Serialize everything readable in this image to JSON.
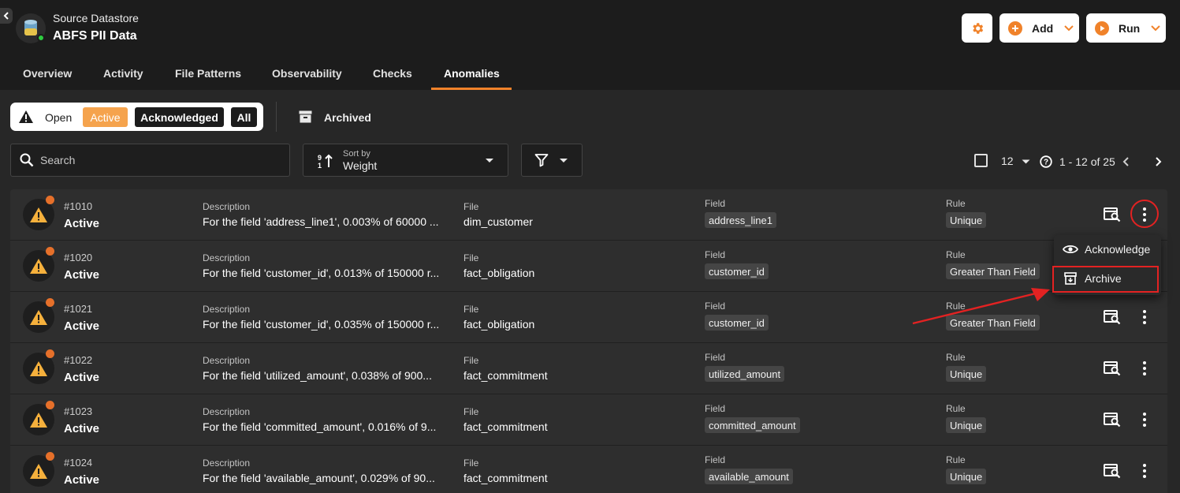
{
  "header": {
    "datastore_label": "Source Datastore",
    "datastore_name": "ABFS PII Data",
    "add_label": "Add",
    "run_label": "Run",
    "accent": "#f0822a"
  },
  "tabs": [
    "Overview",
    "Activity",
    "File Patterns",
    "Observability",
    "Checks",
    "Anomalies"
  ],
  "active_tab": "Anomalies",
  "status_filter": {
    "open": "Open",
    "active": "Active",
    "acknowledged": "Acknowledged",
    "all": "All",
    "archived": "Archived"
  },
  "search": {
    "placeholder": "Search"
  },
  "sort": {
    "small_label": "Sort by",
    "value": "Weight"
  },
  "pagination": {
    "page_size": "12",
    "range": "1 - 12 of 25"
  },
  "labels": {
    "description": "Description",
    "file": "File",
    "field": "Field",
    "rule": "Rule"
  },
  "anomalies": [
    {
      "id": "#1010",
      "status": "Active",
      "description": "For the field 'address_line1', 0.003% of 60000 ...",
      "file": "dim_customer",
      "field": "address_line1",
      "rule": "Unique"
    },
    {
      "id": "#1020",
      "status": "Active",
      "description": "For the field 'customer_id', 0.013% of 150000 r...",
      "file": "fact_obligation",
      "field": "customer_id",
      "rule": "Greater Than Field"
    },
    {
      "id": "#1021",
      "status": "Active",
      "description": "For the field 'customer_id', 0.035% of 150000 r...",
      "file": "fact_obligation",
      "field": "customer_id",
      "rule": "Greater Than Field"
    },
    {
      "id": "#1022",
      "status": "Active",
      "description": "For the field 'utilized_amount', 0.038% of 900...",
      "file": "fact_commitment",
      "field": "utilized_amount",
      "rule": "Unique"
    },
    {
      "id": "#1023",
      "status": "Active",
      "description": "For the field 'committed_amount', 0.016% of 9...",
      "file": "fact_commitment",
      "field": "committed_amount",
      "rule": "Unique"
    },
    {
      "id": "#1024",
      "status": "Active",
      "description": "For the field 'available_amount', 0.029% of 90...",
      "file": "fact_commitment",
      "field": "available_amount",
      "rule": "Unique"
    }
  ],
  "row_menu": {
    "acknowledge": "Acknowledge",
    "archive": "Archive"
  },
  "annotation_color": "#e32222"
}
